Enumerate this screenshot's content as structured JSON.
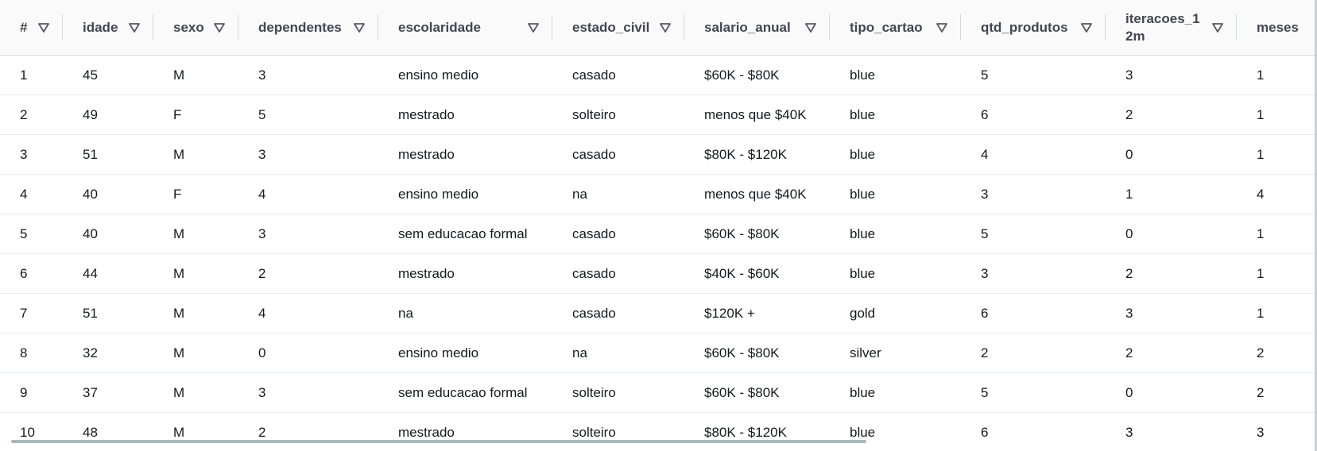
{
  "table": {
    "columns": [
      "#",
      "idade",
      "sexo",
      "dependentes",
      "escolaridade",
      "estado_civil",
      "salario_anual",
      "tipo_cartao",
      "qtd_produtos",
      "iteracoes_12m",
      "meses"
    ],
    "rows": [
      [
        "1",
        "45",
        "M",
        "3",
        "ensino medio",
        "casado",
        "$60K - $80K",
        "blue",
        "5",
        "3",
        "1"
      ],
      [
        "2",
        "49",
        "F",
        "5",
        "mestrado",
        "solteiro",
        "menos que $40K",
        "blue",
        "6",
        "2",
        "1"
      ],
      [
        "3",
        "51",
        "M",
        "3",
        "mestrado",
        "casado",
        "$80K - $120K",
        "blue",
        "4",
        "0",
        "1"
      ],
      [
        "4",
        "40",
        "F",
        "4",
        "ensino medio",
        "na",
        "menos que $40K",
        "blue",
        "3",
        "1",
        "4"
      ],
      [
        "5",
        "40",
        "M",
        "3",
        "sem educacao formal",
        "casado",
        "$60K - $80K",
        "blue",
        "5",
        "0",
        "1"
      ],
      [
        "6",
        "44",
        "M",
        "2",
        "mestrado",
        "casado",
        "$40K - $60K",
        "blue",
        "3",
        "2",
        "1"
      ],
      [
        "7",
        "51",
        "M",
        "4",
        "na",
        "casado",
        "$120K +",
        "gold",
        "6",
        "3",
        "1"
      ],
      [
        "8",
        "32",
        "M",
        "0",
        "ensino medio",
        "na",
        "$60K - $80K",
        "silver",
        "2",
        "2",
        "2"
      ],
      [
        "9",
        "37",
        "M",
        "3",
        "sem educacao formal",
        "solteiro",
        "$60K - $80K",
        "blue",
        "5",
        "0",
        "2"
      ],
      [
        "10",
        "48",
        "M",
        "2",
        "mestrado",
        "solteiro",
        "$80K - $120K",
        "blue",
        "6",
        "3",
        "3"
      ]
    ]
  },
  "icons": {
    "sort": "sort-triangle-down-icon"
  }
}
